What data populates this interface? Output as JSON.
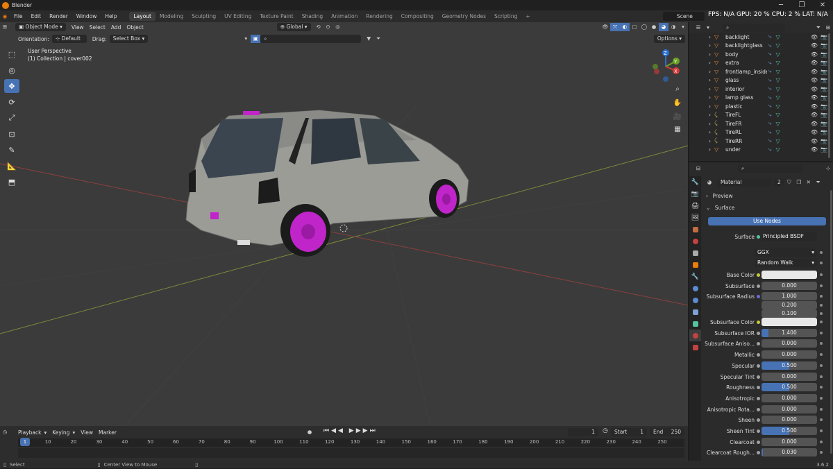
{
  "window": {
    "title": "Blender",
    "min": "─",
    "max": "❐",
    "close": "✕"
  },
  "menu": {
    "items": [
      "File",
      "Edit",
      "Render",
      "Window",
      "Help"
    ],
    "workspaces": [
      "Layout",
      "Modeling",
      "Sculpting",
      "UV Editing",
      "Texture Paint",
      "Shading",
      "Animation",
      "Rendering",
      "Compositing",
      "Geometry Nodes",
      "Scripting"
    ],
    "active_workspace": "Layout",
    "add_tab": "+",
    "scene_label": "Scene",
    "stats": "FPS: N/A GPU: 20 % CPU: 2 % LAT: N/A"
  },
  "viewport": {
    "mode": "Object Mode",
    "menus": [
      "View",
      "Select",
      "Add",
      "Object"
    ],
    "transform": "Global",
    "orientation_label": "Orientation:",
    "orientation_value": "Default",
    "drag_label": "Drag:",
    "drag_value": "Select Box",
    "options": "Options",
    "info_line1": "User Perspective",
    "info_line2": "(1) Collection | cover002",
    "gizmo_labels": {
      "x": "X",
      "y": "Y",
      "z": "Z"
    },
    "tools": [
      "cursor-select",
      "cursor",
      "move",
      "rotate",
      "scale",
      "transform",
      "annotate",
      "measure",
      "add-cube"
    ],
    "active_tool": "move"
  },
  "outliner": {
    "rows": [
      {
        "name": "backlight",
        "icon": "mesh",
        "extra": "2"
      },
      {
        "name": "backlightglass",
        "icon": "mesh",
        "extra": "2"
      },
      {
        "name": "body",
        "icon": "mesh",
        "extra": "2"
      },
      {
        "name": "extra",
        "icon": "mesh",
        "extra": "2"
      },
      {
        "name": "frontlamp_inside",
        "icon": "mesh",
        "extra": ""
      },
      {
        "name": "glass",
        "icon": "mesh",
        "extra": "2"
      },
      {
        "name": "interior",
        "icon": "mesh",
        "extra": "2"
      },
      {
        "name": "lamp glass",
        "icon": "mesh",
        "extra": "2"
      },
      {
        "name": "plastic",
        "icon": "mesh",
        "extra": "2"
      },
      {
        "name": "TireFL",
        "icon": "armature",
        "extra": "2"
      },
      {
        "name": "TireFR",
        "icon": "armature",
        "extra": "2"
      },
      {
        "name": "TireRL",
        "icon": "armature",
        "extra": "2"
      },
      {
        "name": "TireRR",
        "icon": "armature",
        "extra": "2"
      },
      {
        "name": "under",
        "icon": "mesh",
        "extra": "2"
      }
    ]
  },
  "properties": {
    "material_name": "Material",
    "material_users": "2",
    "preview_label": "Preview",
    "surface_label": "Surface",
    "use_nodes_label": "Use Nodes",
    "surface_field_label": "Surface",
    "surface_shader": "Principled BSDF",
    "distribution": "GGX",
    "subsurface_method": "Random Walk",
    "fields": [
      {
        "label": "Base Color",
        "value": "",
        "kind": "color",
        "dot": "#c9c93a"
      },
      {
        "label": "Subsurface",
        "value": "0.000",
        "fill": 0
      },
      {
        "label": "Subsurface Radius",
        "value": "1.000",
        "fill": 0,
        "dot": "#6b6bd8"
      },
      {
        "label": "",
        "value": "0.200",
        "fill": 0
      },
      {
        "label": "",
        "value": "0.100",
        "fill": 0
      },
      {
        "label": "Subsurface Color",
        "value": "",
        "kind": "color",
        "dot": "#c9c93a"
      },
      {
        "label": "Subsurface IOR",
        "value": "1.400",
        "fill": 0.12
      },
      {
        "label": "Subsurface Aniso...",
        "value": "0.000",
        "fill": 0
      },
      {
        "label": "Metallic",
        "value": "0.000",
        "fill": 0
      },
      {
        "label": "Specular",
        "value": "0.500",
        "fill": 0.5
      },
      {
        "label": "Specular Tint",
        "value": "0.000",
        "fill": 0
      },
      {
        "label": "Roughness",
        "value": "0.500",
        "fill": 0.5
      },
      {
        "label": "Anisotropic",
        "value": "0.000",
        "fill": 0
      },
      {
        "label": "Anisotropic Rota...",
        "value": "0.000",
        "fill": 0
      },
      {
        "label": "Sheen",
        "value": "0.000",
        "fill": 0
      },
      {
        "label": "Sheen Tint",
        "value": "0.500",
        "fill": 0.5
      },
      {
        "label": "Clearcoat",
        "value": "0.000",
        "fill": 0
      },
      {
        "label": "Clearcoat Rough...",
        "value": "0.030",
        "fill": 0.03
      }
    ]
  },
  "timeline": {
    "menus": [
      "Playback",
      "Keying",
      "View",
      "Marker"
    ],
    "current_frame": "1",
    "start_label": "Start",
    "start": "1",
    "end_label": "End",
    "end": "250",
    "ticks": [
      "1",
      "10",
      "20",
      "30",
      "40",
      "50",
      "60",
      "70",
      "80",
      "90",
      "100",
      "110",
      "120",
      "130",
      "140",
      "150",
      "160",
      "170",
      "180",
      "190",
      "200",
      "210",
      "220",
      "230",
      "240",
      "250"
    ],
    "cursor_label": "1"
  },
  "status": {
    "select": "Select",
    "center": "Center View to Mouse",
    "version": "3.6.2"
  },
  "colors": {
    "accent": "#4772b3",
    "orange": "#e87d0d",
    "mesh": "#d07a3a",
    "data": "#54c39e"
  }
}
